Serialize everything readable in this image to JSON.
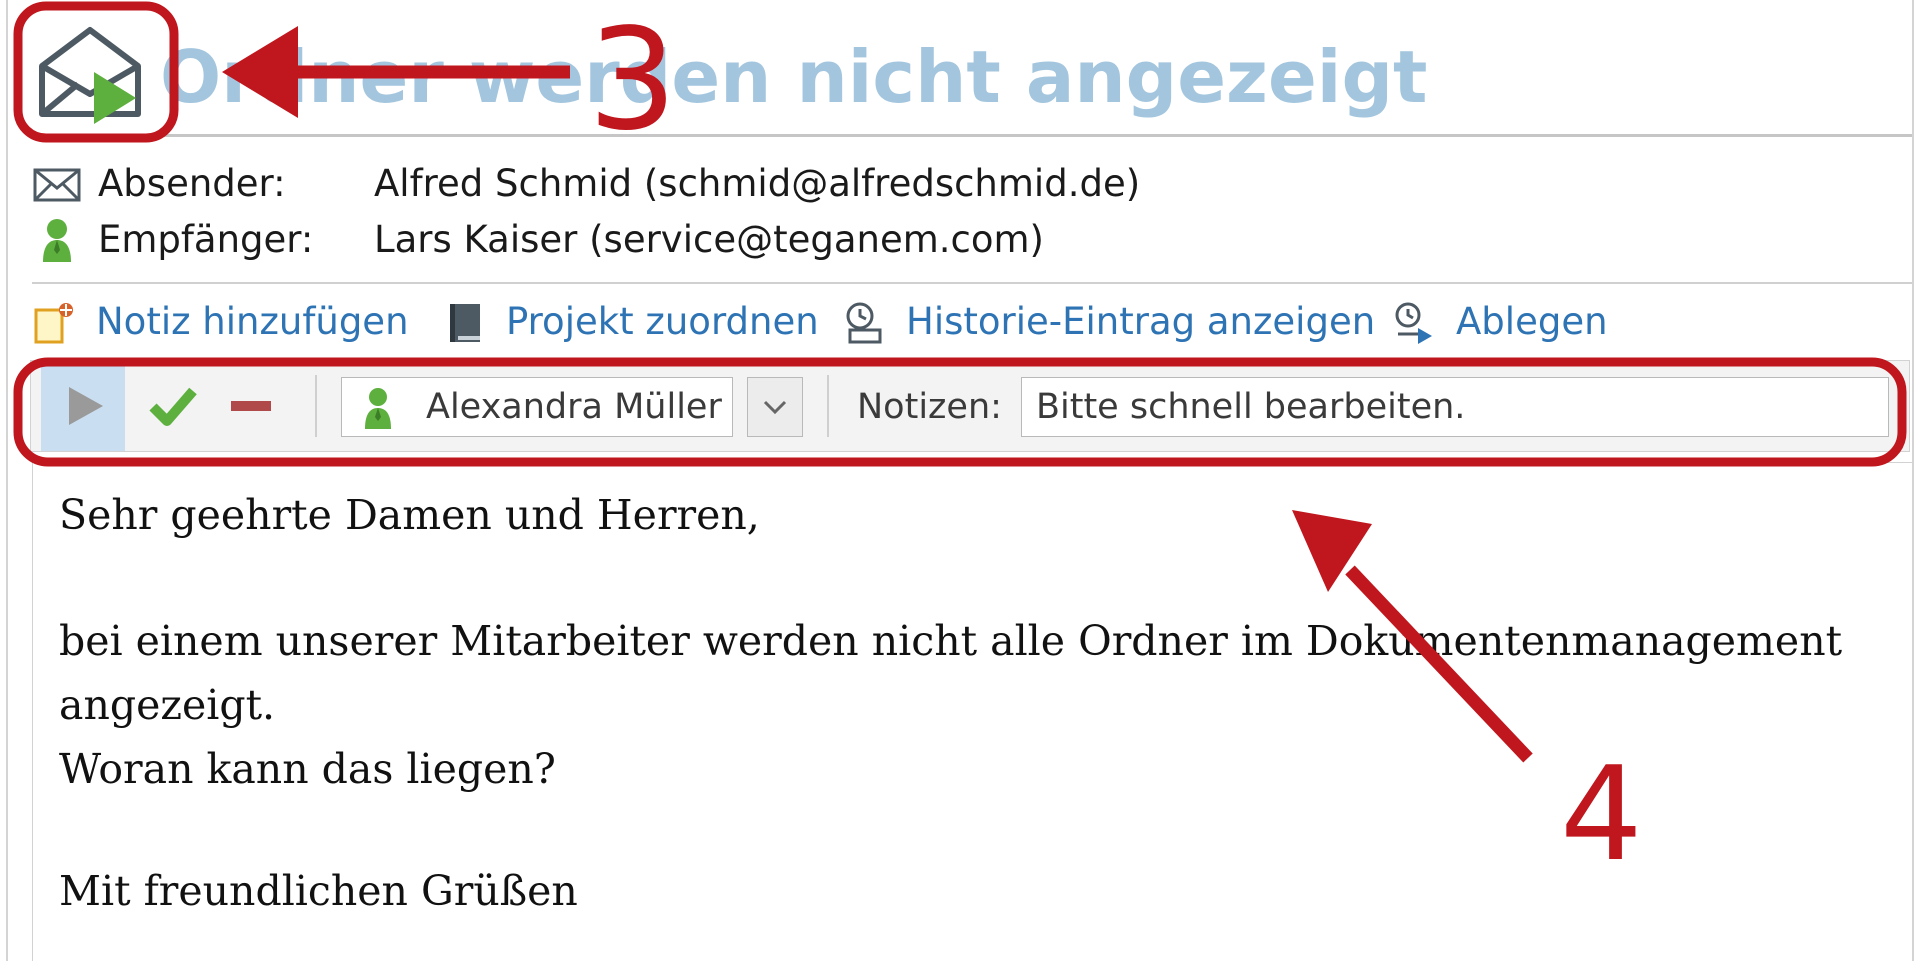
{
  "title": "Ordner werden nicht angezeigt",
  "header": {
    "sender_label": "Absender:",
    "sender_value": "Alfred Schmid (schmid@alfredschmid.de)",
    "recipient_label": "Empfänger:",
    "recipient_value": "Lars Kaiser (service@teganem.com)"
  },
  "actions": [
    {
      "label": "Notiz hinzufügen",
      "icon": "note-add-icon"
    },
    {
      "label": "Projekt zuordnen",
      "icon": "project-book-icon"
    },
    {
      "label": "Historie-Eintrag anzeigen",
      "icon": "history-entry-icon"
    },
    {
      "label": "Ablegen",
      "icon": "file-away-icon"
    }
  ],
  "toolbar": {
    "assignee": "Alexandra Müller",
    "notes_label": "Notizen:",
    "notes_value": "Bitte schnell bearbeiten."
  },
  "body": {
    "lines": [
      "Sehr geehrte Damen und Herren,",
      "bei einem unserer Mitarbeiter werden nicht alle Ordner im Dokumentenmanagement",
      "angezeigt.",
      "Woran kann das liegen?",
      "Mit freundlichen Grüßen"
    ]
  },
  "annotations": {
    "label_3": "3",
    "label_4": "4"
  },
  "colors": {
    "title": "#a3c6de",
    "link": "#2e74b5",
    "annotation": "#c0161d",
    "accept": "#5daf3e",
    "reject": "#b04a4a",
    "start_play": "#9a9a9a",
    "contact": "#5daf3e"
  }
}
